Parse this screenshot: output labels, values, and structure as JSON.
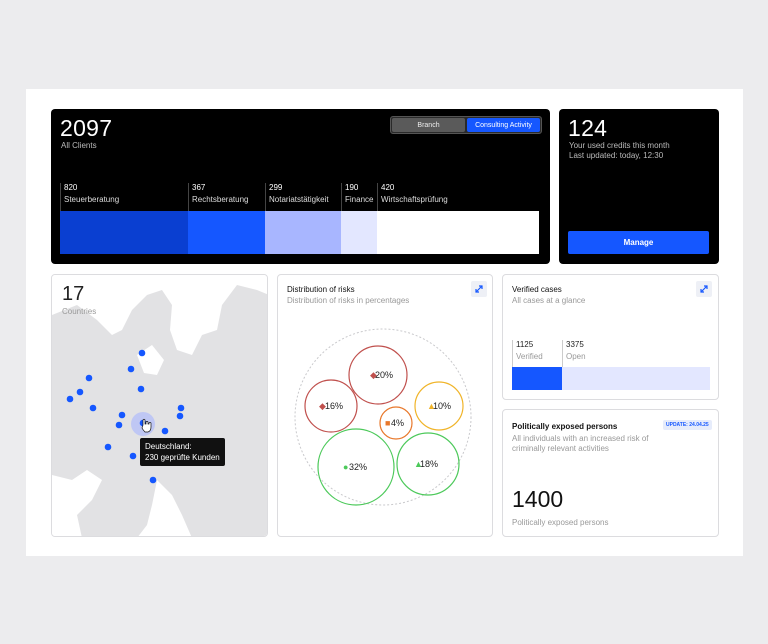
{
  "clients": {
    "total": "2097",
    "total_label": "All Clients",
    "toggle": {
      "branch": "Branch",
      "consulting": "Consulting Activity"
    },
    "segments": [
      {
        "count": "820",
        "label": "Steuerberatung",
        "color": "#0a3fd1"
      },
      {
        "count": "367",
        "label": "Rechtsberatung",
        "color": "#1557ff"
      },
      {
        "count": "299",
        "label": "Notariatstätigkeit",
        "color": "#a8b6ff"
      },
      {
        "count": "190",
        "label": "Finance",
        "color": "#e3e7ff"
      },
      {
        "count": "420",
        "label": "Wirtschaftsprüfung",
        "color": "#ffffff"
      }
    ]
  },
  "credits": {
    "value": "124",
    "line1": "Your used credits this month",
    "line2": "Last updated: today, 12:30",
    "button": "Manage"
  },
  "map": {
    "count": "17",
    "count_label": "Countries",
    "tooltip_title": "Deutschland:",
    "tooltip_value": "230 geprüfte Kunden",
    "accent": "#1557ff"
  },
  "risks": {
    "title": "Distribution of risks",
    "subtitle": "Distribution of risks in percentages",
    "bubbles": [
      {
        "label": "20%",
        "color": "#c0504d"
      },
      {
        "label": "16%",
        "color": "#c0504d"
      },
      {
        "label": "10%",
        "color": "#f0b429"
      },
      {
        "label": "4%",
        "color": "#e8782b"
      },
      {
        "label": "32%",
        "color": "#4cc95a"
      },
      {
        "label": "18%",
        "color": "#4cc95a"
      }
    ]
  },
  "verified": {
    "title": "Verified cases",
    "subtitle": "All cases at a glance",
    "verified_count": "1125",
    "verified_label": "Verified",
    "open_count": "3375",
    "open_label": "Open"
  },
  "pep": {
    "badge": "UPDATE: 24.04.25",
    "title": "Politically exposed persons",
    "subtitle": "All individuals with an increased risk of criminally relevant activities",
    "value": "1400",
    "footer": "Politically exposed persons"
  }
}
